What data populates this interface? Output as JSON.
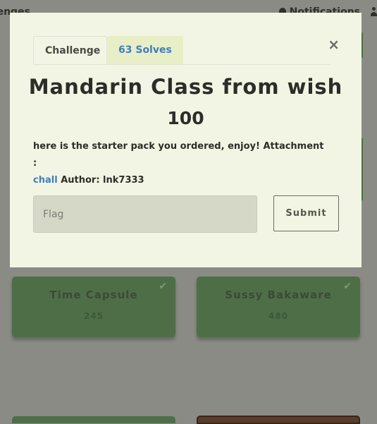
{
  "nav": {
    "left_label": "llenges",
    "notifications_label": "Notifications"
  },
  "modal": {
    "tabs": [
      {
        "label": "Challenge"
      },
      {
        "label": "63 Solves"
      }
    ],
    "close_glyph": "×",
    "title": "Mandarin Class from wish",
    "value": "100",
    "description_text": "here is the starter pack you ordered, enjoy! Attachment :",
    "attachment_link": "chall",
    "author_text": "Author: lnk7333",
    "flag_placeholder": "Flag",
    "submit_label": "Submit"
  },
  "background_cards": [
    {
      "name": "Time Capsule",
      "points": "245",
      "check": "✔"
    },
    {
      "name": "Sussy Bakaware",
      "points": "480",
      "check": "✔"
    }
  ],
  "colors": {
    "overlay_bg": "#8a8b85",
    "modal_bg": "#f2f5e3",
    "solved_card": "#4e6e47",
    "link": "#3b7fc4",
    "bottom_card_brown": "#5a3c2a"
  }
}
